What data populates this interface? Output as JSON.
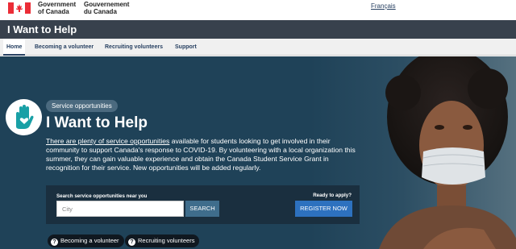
{
  "gov": {
    "name_en_1": "Government",
    "name_en_2": "of Canada",
    "name_fr_1": "Gouvernement",
    "name_fr_2": "du Canada",
    "language_link": "Français"
  },
  "app": {
    "title": "I Want to Help"
  },
  "nav": {
    "items": [
      {
        "label": "Home"
      },
      {
        "label": "Becoming a volunteer"
      },
      {
        "label": "Recruiting volunteers"
      },
      {
        "label": "Support"
      }
    ]
  },
  "hero": {
    "pill": "Service opportunities",
    "title": "I Want to Help",
    "link_text": "There are plenty of service opportunities",
    "body": " available for students looking to get involved in their community to support Canada's response to COVID-19. By volunteering with a local organization this summer, they can gain valuable experience and obtain the Canada Student Service Grant in recognition for their service. New opportunities will be added regularly.",
    "logo_icon": "raised-hand-heart-icon"
  },
  "search": {
    "label": "Search service opportunities near you",
    "placeholder": "City",
    "button": "SEARCH",
    "ready_label": "Ready to apply?",
    "register_button": "REGISTER NOW"
  },
  "faq": {
    "items": [
      {
        "label": "Becoming a volunteer",
        "icon": "question-icon"
      },
      {
        "label": "Recruiting volunteers",
        "icon": "question-icon"
      }
    ]
  },
  "colors": {
    "hero_bg": "#1f4258",
    "register": "#2d71bf",
    "search": "#3f6d8c",
    "flag_red": "#eb2d37"
  }
}
